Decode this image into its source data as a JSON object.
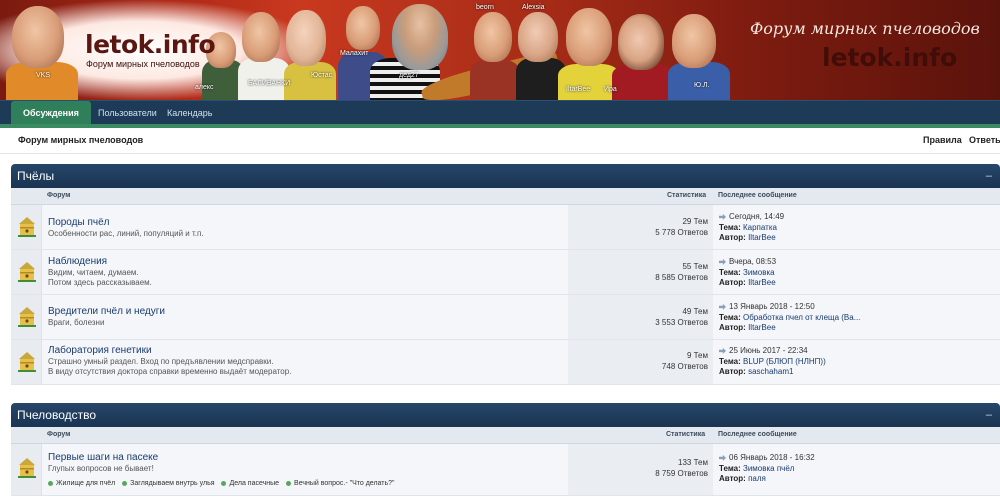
{
  "banner": {
    "logo": "letok.info",
    "logo_sub": "Форум мирных пчеловодов",
    "title_right": "Форум мирных пчеловодов",
    "logo_right": "letok.info",
    "photo_tags": [
      "VKS",
      "алекс",
      "БАЛИВАНКИ",
      "Юстас",
      "Малахит",
      "дед27",
      "beorn",
      "Alexsia",
      "IltarBee",
      "Ира",
      "Ю.Л."
    ]
  },
  "nav": {
    "tabs": [
      {
        "label": "Обсуждения",
        "active": true
      },
      {
        "label": "Пользователи",
        "active": false
      },
      {
        "label": "Календарь",
        "active": false
      }
    ]
  },
  "crumbbar": {
    "crumb": "Форум мирных пчеловодов",
    "links": [
      "Правила",
      "Ответы"
    ]
  },
  "columns": {
    "forum": "Форум",
    "stats": "Статистика",
    "last": "Последнее сообщение"
  },
  "categories": [
    {
      "title": "Пчёлы",
      "collapse": "–",
      "forums": [
        {
          "name": "Породы пчёл",
          "desc": [
            "Особенности рас, линий, популяций и т.п."
          ],
          "topics": "29 Тем",
          "posts": "5 778 Ответов",
          "last_date": "Сегодня, 14:49",
          "topic_label": "Тема:",
          "topic": "Карпатка",
          "author_label": "Автор:",
          "author": "IltarBee"
        },
        {
          "name": "Наблюдения",
          "desc": [
            "Видим, читаем, думаем.",
            "Потом здесь рассказываем."
          ],
          "topics": "55 Тем",
          "posts": "8 585 Ответов",
          "last_date": "Вчера, 08:53",
          "topic_label": "Тема:",
          "topic": "Зимовка",
          "author_label": "Автор:",
          "author": "IltarBee"
        },
        {
          "name": "Вредители пчёл и недуги",
          "desc": [
            "Враги, болезни"
          ],
          "topics": "49 Тем",
          "posts": "3 553 Ответов",
          "last_date": "13 Январь 2018 - 12:50",
          "topic_label": "Тема:",
          "topic": "Обработка пчел от клеща (Ва...",
          "author_label": "Автор:",
          "author": "IltarBee"
        },
        {
          "name": "Лаборатория генетики",
          "desc": [
            "Страшно умный раздел. Вход по предъявлении медсправки.",
            "В виду отсутствия доктора справки временно выдаёт модератор."
          ],
          "topics": "9 Тем",
          "posts": "748 Ответов",
          "last_date": "25 Июнь 2017 - 22:34",
          "topic_label": "Тема:",
          "topic": "BLUP (БЛЮП (НЛНП))",
          "author_label": "Автор:",
          "author": "saschaham1"
        }
      ]
    },
    {
      "title": "Пчеловодство",
      "collapse": "–",
      "forums": [
        {
          "name": "Первые шаги на пасеке",
          "desc": [
            "Глупых вопросов не бывает!"
          ],
          "topics": "133 Тем",
          "posts": "8 759 Ответов",
          "last_date": "06 Январь 2018 - 16:32",
          "topic_label": "Тема:",
          "topic": "Зимовка пчёл",
          "author_label": "Автор:",
          "author": "паля",
          "subforums": [
            "Жилище для пчёл",
            "Заглядываем внутрь улья",
            "Дела пасечные",
            "Вечный вопрос.- \"Что делать?\""
          ]
        }
      ]
    }
  ],
  "colors": {
    "nav_bg": "#1d3a57",
    "nav_active": "#2f7f5a",
    "cat_head": "#1f3d5e",
    "link": "#1a3c6e"
  }
}
